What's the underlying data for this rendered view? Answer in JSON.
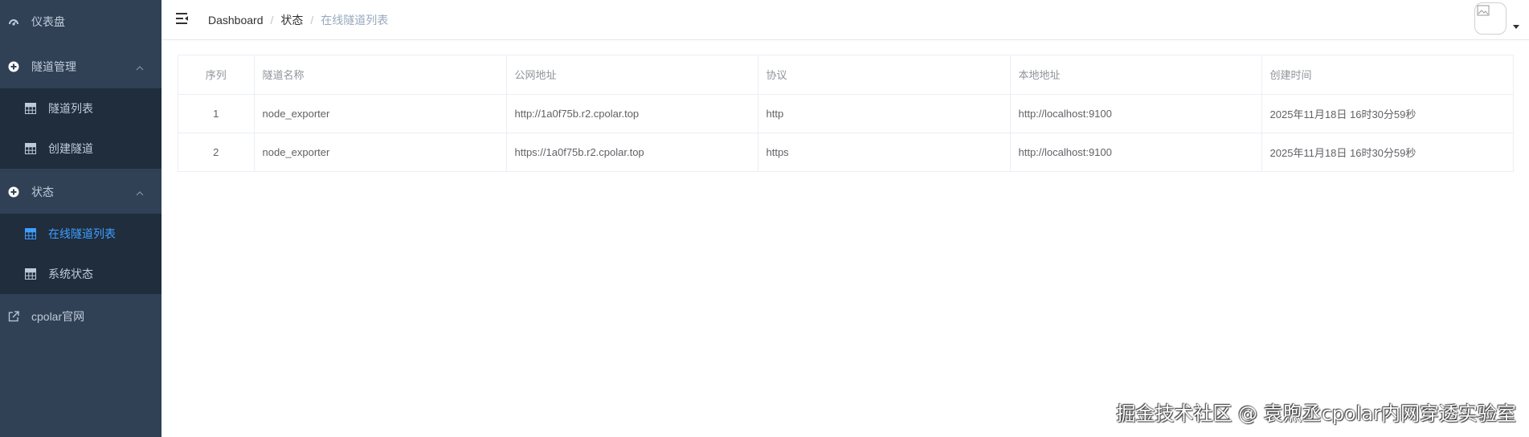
{
  "sidebar": {
    "dashboard": "仪表盘",
    "tunnel_mgmt": "隧道管理",
    "tunnel_list": "隧道列表",
    "create_tunnel": "创建隧道",
    "status": "状态",
    "online_tunnels": "在线隧道列表",
    "system_status": "系统状态",
    "cpolar_site": "cpolar官网"
  },
  "breadcrumb": {
    "home": "Dashboard",
    "sep1": "/",
    "section": "状态",
    "sep2": "/",
    "current": "在线隧道列表"
  },
  "table": {
    "headers": [
      "序列",
      "隧道名称",
      "公网地址",
      "协议",
      "本地地址",
      "创建时间"
    ],
    "rows": [
      [
        "1",
        "node_exporter",
        "http://1a0f75b.r2.cpolar.top",
        "http",
        "http://localhost:9100",
        "2025年11月18日 16时30分59秒"
      ],
      [
        "2",
        "node_exporter",
        "https://1a0f75b.r2.cpolar.top",
        "https",
        "http://localhost:9100",
        "2025年11月18日 16时30分59秒"
      ]
    ]
  },
  "watermark": "掘金技术社区 @ 袁煦丞cpolar内网穿透实验室",
  "colors": {
    "sidebar_bg": "#304156",
    "submenu_bg": "#1f2d3d",
    "sidebar_text": "#bfcbd9",
    "active": "#409eff"
  },
  "icons": {
    "dashboard": "dashboard-icon",
    "tunnel_mgmt": "plus-circle-icon",
    "status": "plus-circle-icon",
    "table": "table-icon",
    "external": "external-link-icon",
    "hamburger": "hamburger-icon"
  }
}
